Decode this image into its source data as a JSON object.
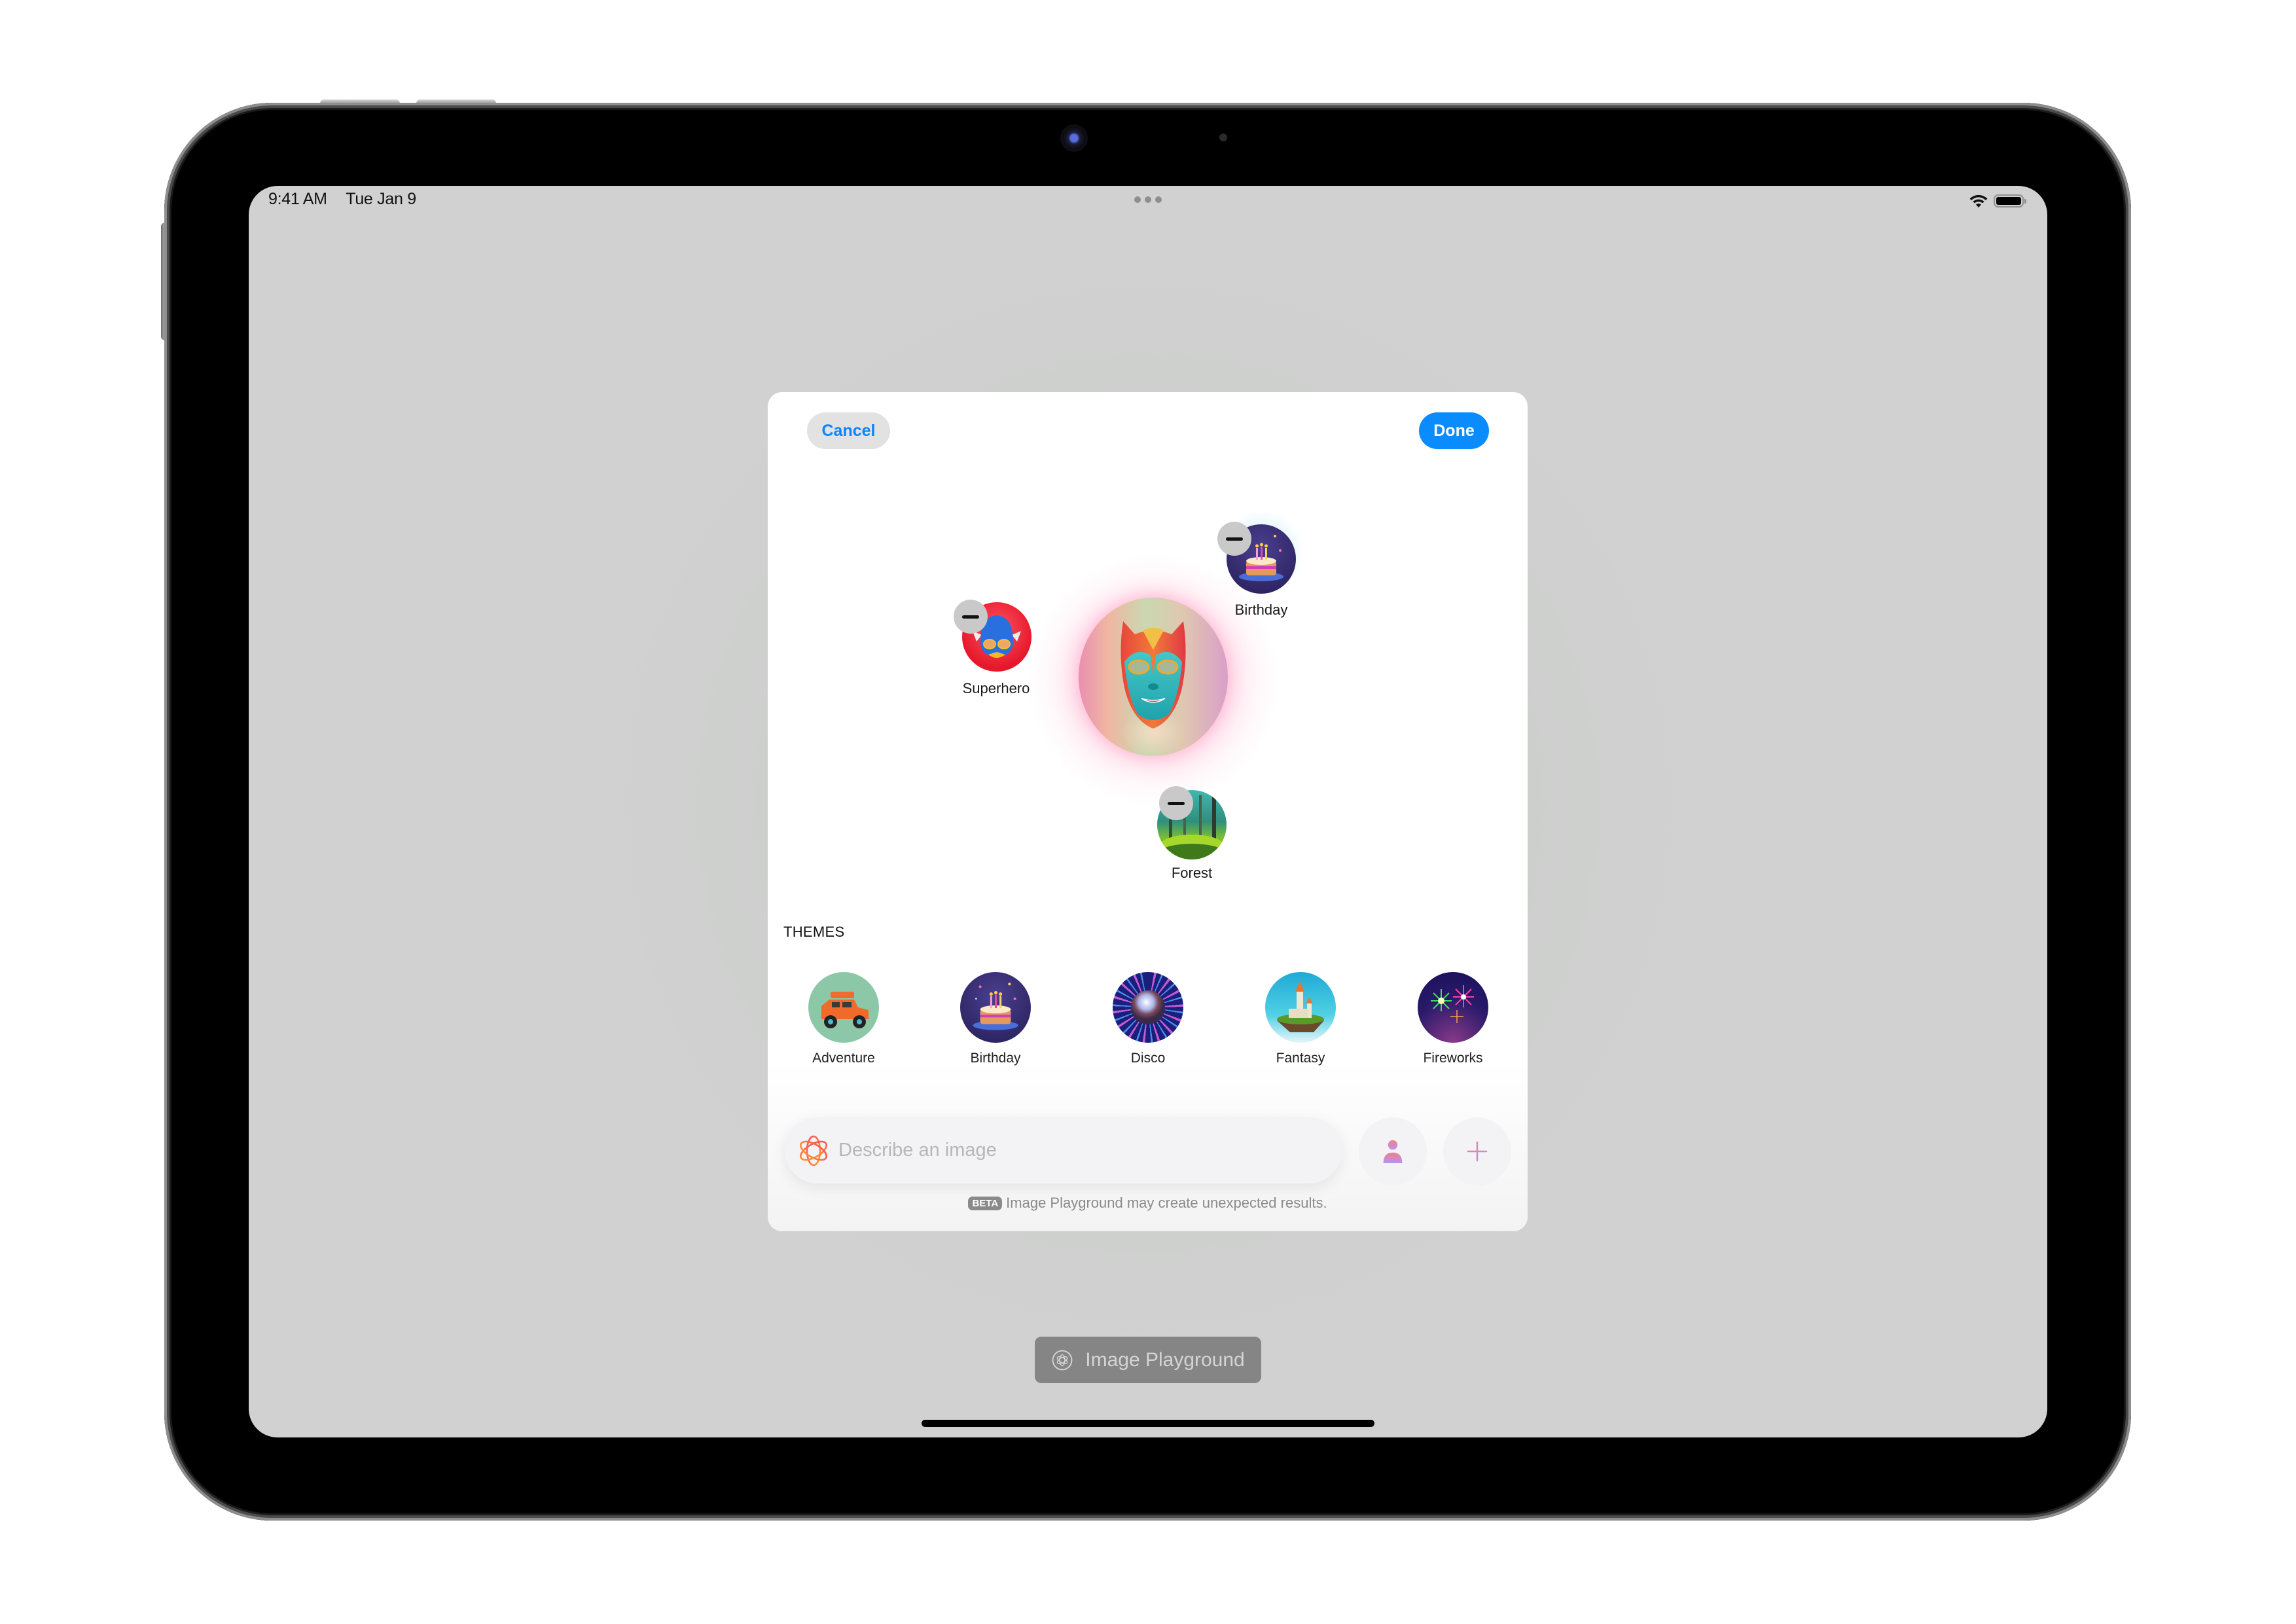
{
  "status_bar": {
    "time": "9:41 AM",
    "date": "Tue Jan 9",
    "wifi_icon": "wifi-icon",
    "battery_icon": "battery-full-icon",
    "multitask_icon": "ellipsis-icon"
  },
  "modal": {
    "cancel_label": "Cancel",
    "done_label": "Done",
    "accent_color": "#0a84ff",
    "selected_concepts": [
      {
        "label": "Superhero",
        "icon": "superhero-helmet-image",
        "remove_icon": "minus-icon"
      },
      {
        "label": "Birthday",
        "icon": "birthday-cake-image",
        "remove_icon": "minus-icon"
      },
      {
        "label": "Forest",
        "icon": "forest-image",
        "remove_icon": "minus-icon"
      }
    ],
    "preview_image": "superhero-mask-preview",
    "themes": {
      "title": "THEMES",
      "items": [
        {
          "label": "Adventure",
          "icon": "adventure-jeep-image"
        },
        {
          "label": "Birthday",
          "icon": "birthday-cake-image"
        },
        {
          "label": "Disco",
          "icon": "disco-ball-image"
        },
        {
          "label": "Fantasy",
          "icon": "fantasy-castle-image"
        },
        {
          "label": "Fireworks",
          "icon": "fireworks-image"
        }
      ]
    },
    "prompt": {
      "placeholder": "Describe an image",
      "value": "",
      "icon": "image-playground-icon",
      "person_button_icon": "person-icon",
      "add_button_icon": "plus-icon"
    },
    "beta_badge": "BETA",
    "disclaimer": "Image Playground may create unexpected results."
  },
  "bottom_button": {
    "label": "Image Playground",
    "icon": "image-playground-icon"
  }
}
